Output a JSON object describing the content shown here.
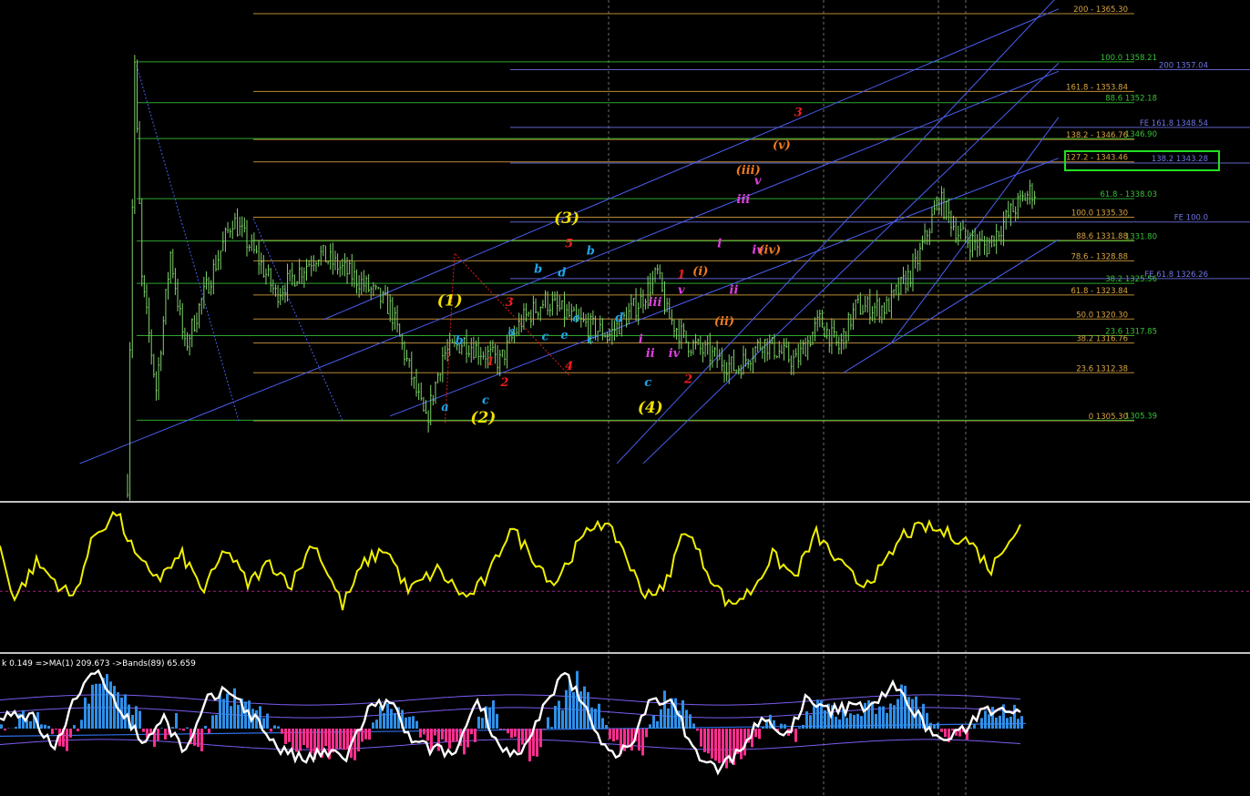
{
  "chart_data": [
    {
      "type": "candlestick",
      "panel": "price",
      "ylim": [
        1299.0,
        1369.0
      ],
      "grid": false,
      "x_range": [
        0,
        380
      ],
      "price_series": {
        "color": "#7fd36a",
        "start_price": 1296,
        "anchors": [
          [
            0,
            1296
          ],
          [
            3,
            1358
          ],
          [
            6,
            1326
          ],
          [
            12,
            1310
          ],
          [
            18,
            1330
          ],
          [
            24,
            1316
          ],
          [
            30,
            1322
          ],
          [
            44,
            1335
          ],
          [
            55,
            1329
          ],
          [
            62,
            1324
          ],
          [
            80,
            1330
          ],
          [
            97,
            1326
          ],
          [
            110,
            1322
          ],
          [
            125,
            1305
          ],
          [
            132,
            1315
          ],
          [
            141,
            1317
          ],
          [
            156,
            1314
          ],
          [
            165,
            1320
          ],
          [
            175,
            1323
          ],
          [
            188,
            1320
          ],
          [
            202,
            1318
          ],
          [
            215,
            1323
          ],
          [
            222,
            1327
          ],
          [
            226,
            1321
          ],
          [
            234,
            1317
          ],
          [
            244,
            1315
          ],
          [
            255,
            1313
          ],
          [
            266,
            1317
          ],
          [
            280,
            1314
          ],
          [
            290,
            1320
          ],
          [
            298,
            1316
          ],
          [
            305,
            1322
          ],
          [
            318,
            1322
          ],
          [
            322,
            1324
          ],
          [
            330,
            1328
          ],
          [
            340,
            1338
          ],
          [
            348,
            1333
          ],
          [
            352,
            1332
          ],
          [
            360,
            1331
          ],
          [
            370,
            1336
          ],
          [
            378,
            1339
          ]
        ]
      },
      "horizontal_levels": [
        {
          "text": "200 - 1365.30",
          "price": 1365.3,
          "color": "#d9a441",
          "x_from": 90
        },
        {
          "text": "100.0 1358.21",
          "price": 1358.21,
          "color": "#37c237",
          "x_from": 2
        },
        {
          "text": "200 1357.04",
          "price": 1357.04,
          "color": "#6f74e6",
          "x_from": 186
        },
        {
          "text": "161.8 - 1353.84",
          "price": 1353.84,
          "color": "#d9a441",
          "x_from": 90
        },
        {
          "text": "88.6 1352.18",
          "price": 1352.18,
          "color": "#37c237",
          "x_from": 2
        },
        {
          "text": "FE 161.8 1348.54",
          "price": 1348.54,
          "color": "#6f74e6",
          "x_from": 186
        },
        {
          "text": "138.2 - 1346.76",
          "price": 1346.76,
          "color": "#d9a441",
          "x_from": 90
        },
        {
          "text": "1346.90",
          "price": 1346.9,
          "color": "#37c237",
          "x_from": 2
        },
        {
          "text": "127.2 - 1343.46",
          "price": 1343.46,
          "color": "#d9a441",
          "x_from": 90
        },
        {
          "text": "138.2 1343.28",
          "price": 1343.28,
          "color": "#6f74e6",
          "x_from": 186
        },
        {
          "text": "61.8 - 1338.03",
          "price": 1338.03,
          "color": "#37c237",
          "x_from": 2
        },
        {
          "text": "100.0 1335.30",
          "price": 1335.3,
          "color": "#d9a441",
          "x_from": 90
        },
        {
          "text": "FE 100.0",
          "price": 1334.6,
          "color": "#6f74e6",
          "x_from": 186
        },
        {
          "text": "88.6 1331.88",
          "price": 1331.88,
          "color": "#d9a441",
          "x_from": 90
        },
        {
          "text": "1331.80",
          "price": 1331.8,
          "color": "#37c237",
          "x_from": 2
        },
        {
          "text": "78.6 - 1328.88",
          "price": 1328.88,
          "color": "#d9a441",
          "x_from": 90
        },
        {
          "text": "FE 61.8 1326.26",
          "price": 1326.26,
          "color": "#6f74e6",
          "x_from": 186
        },
        {
          "text": "38.2 1325.56",
          "price": 1325.56,
          "color": "#37c237",
          "x_from": 2
        },
        {
          "text": "61.8 - 1323.84",
          "price": 1323.84,
          "color": "#d9a441",
          "x_from": 90
        },
        {
          "text": "50.0 1320.30",
          "price": 1320.3,
          "color": "#d9a441",
          "x_from": 90
        },
        {
          "text": "23.6 1317.85",
          "price": 1317.85,
          "color": "#37c237",
          "x_from": 2
        },
        {
          "text": "38.2 1316.76",
          "price": 1316.76,
          "color": "#d9a441",
          "x_from": 90
        },
        {
          "text": "23.6 1312.38",
          "price": 1312.38,
          "color": "#d9a441",
          "x_from": 90
        },
        {
          "text": "0 1305.30",
          "price": 1305.3,
          "color": "#d9a441",
          "x_from": 90
        },
        {
          "text": "1305.39",
          "price": 1305.39,
          "color": "#37c237",
          "x_from": 2
        }
      ],
      "highlight_level": "127.2 - 1343.46   138.2 1343.28",
      "highlight_color": "#22e022",
      "channel_lines": [
        {
          "from": [
            -20,
            1299.0
          ],
          "to": [
            390,
            1356.8
          ]
        },
        {
          "from": [
            82,
            1320.2
          ],
          "to": [
            390,
            1366.0
          ]
        },
        {
          "from": [
            110,
            1306.0
          ],
          "to": [
            390,
            1344.0
          ]
        },
        {
          "from": [
            205,
            1299.0
          ],
          "to": [
            390,
            1368.0
          ]
        },
        {
          "from": [
            300,
            1312.4
          ],
          "to": [
            390,
            1332.0
          ]
        },
        {
          "from": [
            320,
            1316.8
          ],
          "to": [
            390,
            1350.0
          ]
        },
        {
          "from": [
            216,
            1299.0
          ],
          "to": [
            390,
            1358.0
          ]
        }
      ],
      "wave_labels": [
        {
          "text": "(1)",
          "x": 135,
          "price": 1322.3,
          "color": "#f0e000"
        },
        {
          "text": "(2)",
          "x": 149,
          "price": 1305.0,
          "color": "#f0e000"
        },
        {
          "text": "(3)",
          "x": 184,
          "price": 1334.4,
          "color": "#f0e000"
        },
        {
          "text": "(4)",
          "x": 219,
          "price": 1306.5,
          "color": "#f0e000"
        },
        {
          "text": "a",
          "x": 133,
          "price": 1306.8,
          "color": "#1ea6ea"
        },
        {
          "text": "b",
          "x": 139,
          "price": 1316.6,
          "color": "#1ea6ea"
        },
        {
          "text": "c",
          "x": 150,
          "price": 1307.8,
          "color": "#1ea6ea"
        },
        {
          "text": "a",
          "x": 161,
          "price": 1317.9,
          "color": "#1ea6ea"
        },
        {
          "text": "b",
          "x": 172,
          "price": 1327.1,
          "color": "#1ea6ea"
        },
        {
          "text": "c",
          "x": 175,
          "price": 1317.2,
          "color": "#1ea6ea"
        },
        {
          "text": "d",
          "x": 182,
          "price": 1326.6,
          "color": "#1ea6ea"
        },
        {
          "text": "e",
          "x": 183,
          "price": 1317.4,
          "color": "#1ea6ea"
        },
        {
          "text": "a",
          "x": 188,
          "price": 1319.9,
          "color": "#1ea6ea"
        },
        {
          "text": "b",
          "x": 194,
          "price": 1329.8,
          "color": "#1ea6ea"
        },
        {
          "text": "c",
          "x": 194,
          "price": 1316.8,
          "color": "#1ea6ea"
        },
        {
          "text": "d",
          "x": 206,
          "price": 1319.9,
          "color": "#1ea6ea"
        },
        {
          "text": "c",
          "x": 218,
          "price": 1310.4,
          "color": "#1ea6ea"
        },
        {
          "text": "1",
          "x": 152,
          "price": 1313.5,
          "color": "#f01e1e"
        },
        {
          "text": "2",
          "x": 158,
          "price": 1310.4,
          "color": "#f01e1e"
        },
        {
          "text": "3",
          "x": 160,
          "price": 1322.2,
          "color": "#f01e1e"
        },
        {
          "text": "4",
          "x": 185,
          "price": 1312.8,
          "color": "#f01e1e"
        },
        {
          "text": "5",
          "x": 185,
          "price": 1330.9,
          "color": "#f01e1e"
        },
        {
          "text": "1",
          "x": 232,
          "price": 1326.3,
          "color": "#f01e1e"
        },
        {
          "text": "2",
          "x": 235,
          "price": 1310.9,
          "color": "#f01e1e"
        },
        {
          "text": "3",
          "x": 281,
          "price": 1350.2,
          "color": "#f01e1e"
        },
        {
          "text": "i",
          "x": 215,
          "price": 1316.8,
          "color": "#e040e0"
        },
        {
          "text": "ii",
          "x": 219,
          "price": 1314.7,
          "color": "#e040e0"
        },
        {
          "text": "iii",
          "x": 221,
          "price": 1322.2,
          "color": "#e040e0"
        },
        {
          "text": "iv",
          "x": 229,
          "price": 1314.7,
          "color": "#e040e0"
        },
        {
          "text": "v",
          "x": 232,
          "price": 1324.0,
          "color": "#e040e0"
        },
        {
          "text": "i",
          "x": 248,
          "price": 1330.9,
          "color": "#e040e0"
        },
        {
          "text": "ii",
          "x": 254,
          "price": 1324.0,
          "color": "#e040e0"
        },
        {
          "text": "iii",
          "x": 258,
          "price": 1337.4,
          "color": "#e040e0"
        },
        {
          "text": "iv",
          "x": 264,
          "price": 1329.9,
          "color": "#e040e0"
        },
        {
          "text": "v",
          "x": 264,
          "price": 1340.1,
          "color": "#e040e0"
        },
        {
          "text": "(i)",
          "x": 240,
          "price": 1326.8,
          "color": "#f07a1e"
        },
        {
          "text": "(ii)",
          "x": 250,
          "price": 1319.4,
          "color": "#f07a1e"
        },
        {
          "text": "(iii)",
          "x": 260,
          "price": 1341.7,
          "color": "#f07a1e"
        },
        {
          "text": "(iv)",
          "x": 269,
          "price": 1329.9,
          "color": "#f07a1e"
        },
        {
          "text": "(v)",
          "x": 274,
          "price": 1345.4,
          "color": "#f07a1e"
        }
      ]
    },
    {
      "type": "line",
      "panel": "oscillator",
      "color": "#f0f000",
      "ylim": [
        0,
        100
      ],
      "reference_level": 40,
      "anchors": [
        [
          0,
          70
        ],
        [
          4,
          35
        ],
        [
          10,
          60
        ],
        [
          16,
          45
        ],
        [
          20,
          35
        ],
        [
          26,
          80
        ],
        [
          32,
          95
        ],
        [
          38,
          60
        ],
        [
          44,
          50
        ],
        [
          50,
          65
        ],
        [
          56,
          40
        ],
        [
          62,
          70
        ],
        [
          68,
          45
        ],
        [
          74,
          60
        ],
        [
          80,
          45
        ],
        [
          86,
          75
        ],
        [
          94,
          30
        ],
        [
          100,
          60
        ],
        [
          106,
          70
        ],
        [
          112,
          40
        ],
        [
          120,
          55
        ],
        [
          128,
          35
        ],
        [
          134,
          50
        ],
        [
          140,
          85
        ],
        [
          146,
          65
        ],
        [
          152,
          45
        ],
        [
          158,
          70
        ],
        [
          164,
          90
        ],
        [
          170,
          75
        ],
        [
          176,
          40
        ],
        [
          182,
          40
        ],
        [
          188,
          85
        ],
        [
          194,
          55
        ],
        [
          200,
          30
        ],
        [
          206,
          40
        ],
        [
          212,
          65
        ],
        [
          218,
          50
        ],
        [
          224,
          80
        ],
        [
          230,
          60
        ],
        [
          236,
          45
        ],
        [
          242,
          55
        ],
        [
          248,
          80
        ],
        [
          254,
          85
        ],
        [
          260,
          80
        ],
        [
          266,
          75
        ],
        [
          272,
          55
        ],
        [
          276,
          75
        ],
        [
          280,
          85
        ]
      ]
    },
    {
      "type": "bar",
      "panel": "histogram",
      "header": "k 0.149  =>MA(1) 209.673  ->Bands(89) 65.659",
      "ylim": [
        -100,
        100
      ],
      "positive_color": "#2f8fe8",
      "negative_color": "#ff2f8f",
      "line_color": "#ffffff",
      "band_color": "#7c5cf0",
      "bands": [
        45,
        25,
        -25
      ],
      "anchors": [
        [
          0,
          0
        ],
        [
          6,
          25
        ],
        [
          12,
          15
        ],
        [
          18,
          -30
        ],
        [
          24,
          50
        ],
        [
          30,
          80
        ],
        [
          36,
          30
        ],
        [
          42,
          -20
        ],
        [
          48,
          15
        ],
        [
          54,
          -35
        ],
        [
          60,
          40
        ],
        [
          66,
          55
        ],
        [
          72,
          20
        ],
        [
          80,
          -30
        ],
        [
          86,
          -45
        ],
        [
          92,
          -35
        ],
        [
          98,
          -40
        ],
        [
          104,
          25
        ],
        [
          110,
          40
        ],
        [
          116,
          -20
        ],
        [
          122,
          -30
        ],
        [
          128,
          -35
        ],
        [
          134,
          45
        ],
        [
          140,
          -25
        ],
        [
          146,
          -40
        ],
        [
          152,
          25
        ],
        [
          158,
          80
        ],
        [
          164,
          25
        ],
        [
          170,
          -35
        ],
        [
          176,
          -30
        ],
        [
          182,
          50
        ],
        [
          188,
          30
        ],
        [
          194,
          -35
        ],
        [
          200,
          -60
        ],
        [
          206,
          -30
        ],
        [
          212,
          15
        ],
        [
          218,
          -15
        ],
        [
          224,
          40
        ],
        [
          230,
          25
        ],
        [
          236,
          30
        ],
        [
          242,
          35
        ],
        [
          248,
          60
        ],
        [
          254,
          25
        ],
        [
          260,
          -15
        ],
        [
          266,
          -10
        ],
        [
          272,
          25
        ],
        [
          278,
          30
        ]
      ]
    }
  ]
}
